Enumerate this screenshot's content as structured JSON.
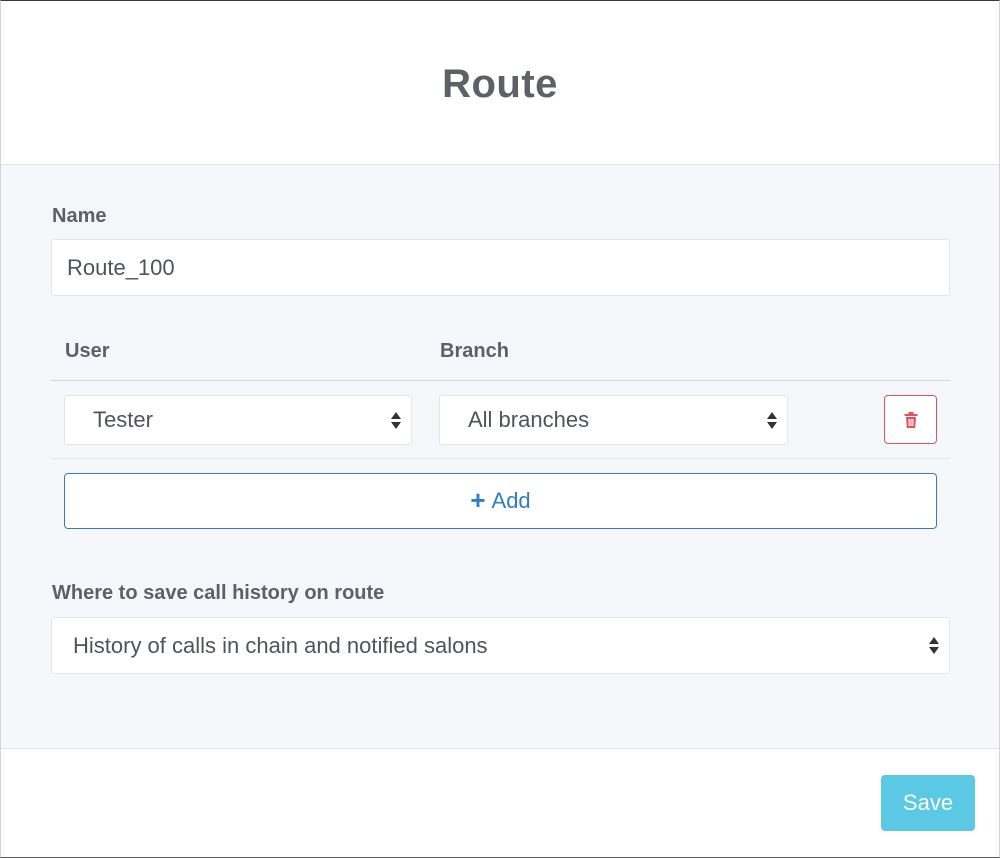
{
  "modal": {
    "title": "Route"
  },
  "form": {
    "name_label": "Name",
    "name_value": "Route_100",
    "table": {
      "columns": [
        "User",
        "Branch"
      ],
      "rows": [
        {
          "user": "Tester",
          "branch": "All branches"
        }
      ],
      "delete_icon": "trash-icon",
      "add_icon": "plus-icon",
      "add_label": "Add"
    },
    "history_label": "Where to save call history on route",
    "history_value": "History of calls in chain and notified salons"
  },
  "footer": {
    "save_label": "Save"
  },
  "colors": {
    "body_bg": "#f5f7fb",
    "add_button": "#2f7ec0",
    "delete_button": "#e0535b",
    "save_button": "#5bc9e4"
  }
}
